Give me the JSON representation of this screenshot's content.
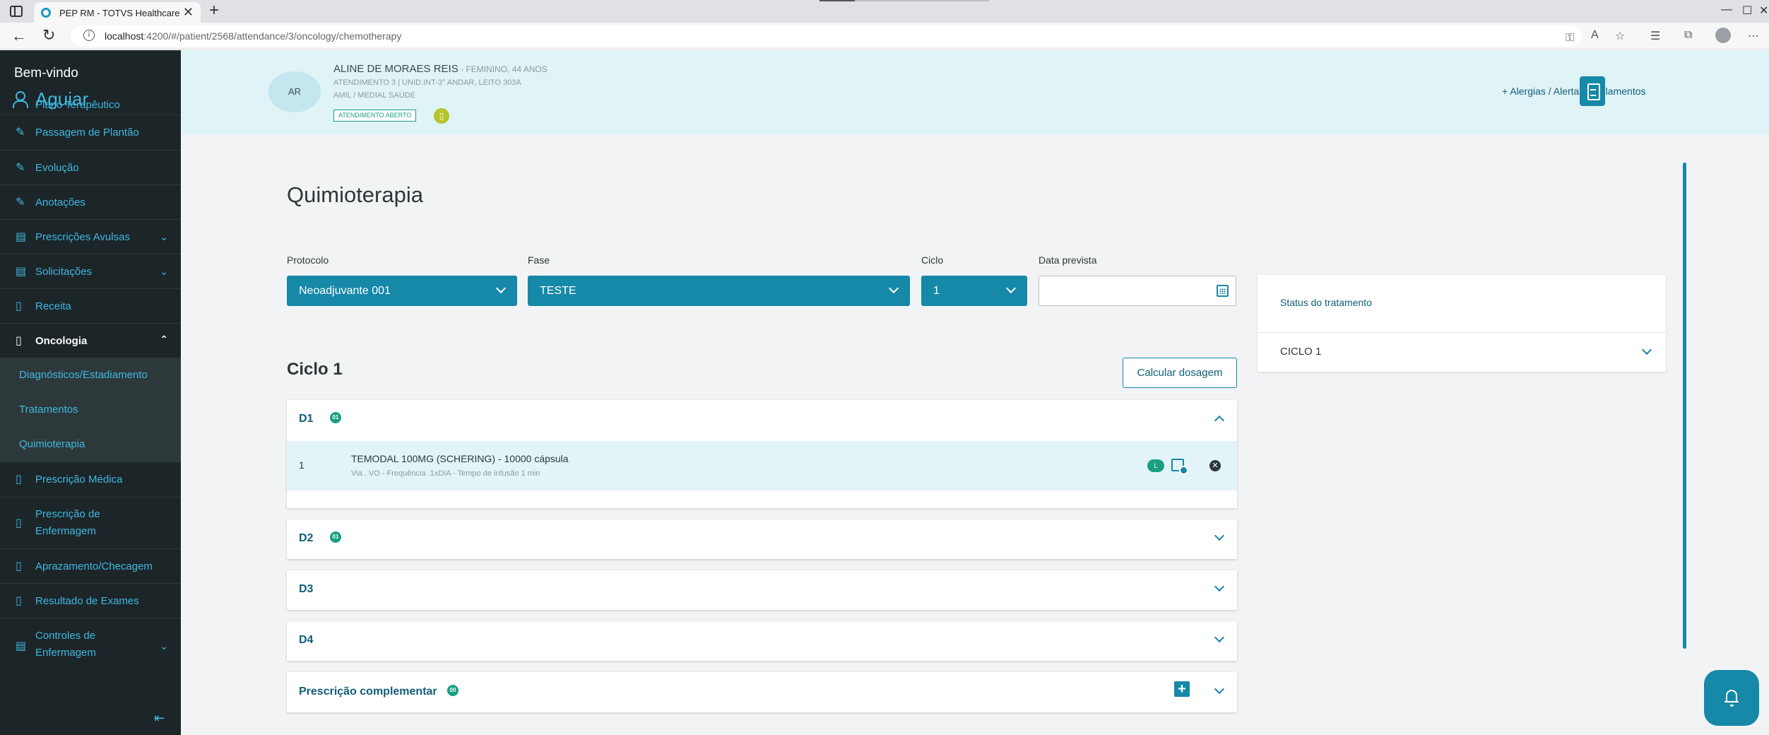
{
  "browser": {
    "tab_title": "PEP RM - TOTVS Healthcare",
    "tab_close": "✕",
    "new_tab": "+",
    "url_host": "localhost",
    "url_path": ":4200/#/patient/2568/attendance/3/oncology/chemotherapy"
  },
  "sidebar": {
    "welcome": "Bem-vindo",
    "user_name": "Aguiar",
    "items": [
      {
        "label": "Plano Terapêutico",
        "icon": "pencil-icon"
      },
      {
        "label": "Passagem de Plantão",
        "icon": "pencil-icon"
      },
      {
        "label": "Evolução",
        "icon": "pencil-icon"
      },
      {
        "label": "Anotações",
        "icon": "pencil-icon"
      },
      {
        "label": "Prescrições Avulsas",
        "icon": "clipboard-icon"
      },
      {
        "label": "Solicitações",
        "icon": "clipboard-icon"
      },
      {
        "label": "Receita",
        "icon": "document-icon"
      },
      {
        "label": "Oncologia",
        "icon": "document-icon"
      },
      {
        "label": "Prescrição Médica",
        "icon": "document-icon"
      },
      {
        "label": "Prescrição de",
        "label2": "Enfermagem",
        "icon": "document-icon"
      },
      {
        "label": "Aprazamento/Checagem",
        "icon": "document-icon"
      },
      {
        "label": "Resultado de Exames",
        "icon": "document-icon"
      },
      {
        "label": "Controles de",
        "label2": "Enfermagem",
        "icon": "clipboard-icon"
      }
    ],
    "subitems": [
      {
        "label": "Diagnósticos/Estadiamento"
      },
      {
        "label": "Tratamentos"
      },
      {
        "label": "Quimioterapia"
      }
    ]
  },
  "patient": {
    "initials": "AR",
    "name": "ALINE DE MORAES REIS",
    "demographics": " - FEMININO, 44 ANOS",
    "attendance": "ATENDIMENTO 3 | UNID.INT-3° ANDAR, LEITO 303A",
    "insurance": "AMIL / MEDIAL SAÚDE",
    "status": "ATENDIMENTO ABERTO",
    "alerts_link": "+  Alergias / Alertas / Isolamentos"
  },
  "page": {
    "title": "Quimioterapia",
    "filters": {
      "protocol_label": "Protocolo",
      "protocol_value": "Neoadjuvante 001",
      "phase_label": "Fase",
      "phase_value": "TESTE",
      "cycle_label": "Ciclo",
      "cycle_value": "1",
      "date_label": "Data prevista",
      "date_value": ""
    },
    "cycle_title": "Ciclo 1",
    "calc_button": "Calcular dosagem",
    "days": [
      {
        "title": "D1",
        "badge": "01",
        "expanded": true
      },
      {
        "title": "D2",
        "badge": "01",
        "expanded": false
      },
      {
        "title": "D3",
        "badge": "",
        "expanded": false
      },
      {
        "title": "D4",
        "badge": "",
        "expanded": false
      }
    ],
    "drug": {
      "index": "1",
      "name": "TEMODAL 100MG (SCHERING) - 10000 cápsula",
      "meta": "Via . VO - Frequência .1xDIA - Tempo de infusão 1 min",
      "tag": "L",
      "remove": "✕"
    },
    "complementary": {
      "title": "Prescrição complementar",
      "badge": "00",
      "add": "+"
    },
    "status_card": {
      "title": "Status do tratamento",
      "cycle": "CICLO 1"
    }
  },
  "colors": {
    "primary": "#1688a8",
    "sidebar_bg": "#1c2528",
    "sidebar_link": "#3fb8e0",
    "header_bg": "#e0f3f7",
    "success": "#1a9f83",
    "status_dot": "#b5c52a"
  }
}
